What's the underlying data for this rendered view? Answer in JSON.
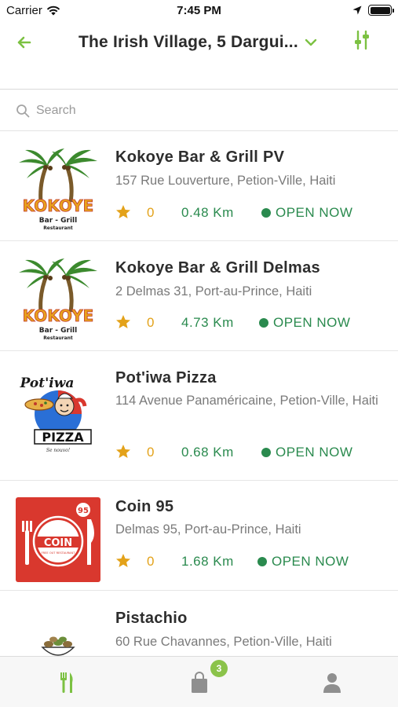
{
  "status_bar": {
    "carrier": "Carrier",
    "time": "7:45 PM"
  },
  "nav": {
    "title": "The Irish Village, 5 Dargui..."
  },
  "search": {
    "placeholder": "Search"
  },
  "restaurants": [
    {
      "name": "Kokoye Bar & Grill PV",
      "address": "157 Rue Louverture, Petion-Ville, Haiti",
      "rating": "0",
      "distance": "0.48 Km",
      "status": "OPEN NOW",
      "logo": "kokoye-logo"
    },
    {
      "name": "Kokoye Bar & Grill Delmas",
      "address": "2 Delmas 31, Port-au-Prince, Haiti",
      "rating": "0",
      "distance": "4.73 Km",
      "status": "OPEN NOW",
      "logo": "kokoye-logo"
    },
    {
      "name": "Pot'iwa Pizza",
      "address": "114 Avenue Panaméricaine, Petion-Ville, Haiti",
      "rating": "0",
      "distance": "0.68 Km",
      "status": "OPEN NOW",
      "logo": "potiwa-logo"
    },
    {
      "name": "Coin 95",
      "address": "Delmas 95, Port-au-Prince, Haiti",
      "rating": "0",
      "distance": "1.68 Km",
      "status": "OPEN NOW",
      "logo": "coin95-logo"
    },
    {
      "name": "Pistachio",
      "address": "60 Rue Chavannes, Petion-Ville, Haiti",
      "logo": "pistachio-logo"
    }
  ],
  "logos": {
    "kokoye_text": "KOKOYE",
    "kokoye_sub": "Bar - Grill",
    "kokoye_sub2": "Restaurant",
    "potiwa_top": "Pot'iwa",
    "potiwa_bottom": "PIZZA",
    "potiwa_tag": "Se nouvo!",
    "coin_number": "95",
    "coin_word": "COIN",
    "coin_tag": "FREE OUT RESTAURANT"
  },
  "tab_bar": {
    "tabs": [
      "restaurants-tab",
      "orders-tab",
      "profile-tab"
    ],
    "badge": "3"
  },
  "colors": {
    "accent": "#8bc34a",
    "open": "#2a8a4e",
    "rating": "#e3a21a",
    "coin_red": "#d9382e"
  }
}
